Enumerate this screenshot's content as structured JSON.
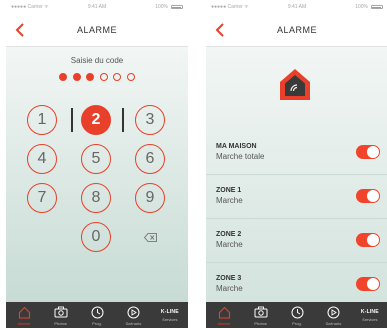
{
  "colors": {
    "accent": "#e8402a",
    "toggle_on": "#f0452b",
    "tab_bar": "#3a3a3a"
  },
  "status_bar": {
    "carrier": "●●●●● Carrier ᯤ",
    "time": "9:41 AM",
    "battery": "100%",
    "battery_level": 1.0
  },
  "keypad_screen": {
    "title": "ALARME",
    "code_label": "Saisie du code",
    "code_length": 6,
    "entered_digits": 3,
    "keys": [
      "1",
      "2",
      "3",
      "4",
      "5",
      "6",
      "7",
      "8",
      "9",
      "0"
    ],
    "active_key": "2",
    "delete_icon": "backspace-icon"
  },
  "alarm_screen": {
    "title": "ALARME",
    "house_icon": "house-wifi-icon",
    "zones": [
      {
        "name": "MA MAISON",
        "status": "Marche totale",
        "enabled": true
      },
      {
        "name": "ZONE 1",
        "status": "Marche",
        "enabled": true
      },
      {
        "name": "ZONE 2",
        "status": "Marche",
        "enabled": true
      },
      {
        "name": "ZONE 3",
        "status": "Marche",
        "enabled": true
      }
    ]
  },
  "tab_bar": {
    "items": [
      {
        "label": "Alarme",
        "icon": "house-icon",
        "active": true
      },
      {
        "label": "Photos",
        "icon": "camera-icon",
        "active": false
      },
      {
        "label": "Prog.",
        "icon": "clock-icon",
        "active": false
      },
      {
        "label": "Scénario",
        "icon": "play-icon",
        "active": false
      },
      {
        "label": "Services",
        "icon": "k-line-logo",
        "brand": "K-LINE",
        "active": false
      }
    ]
  }
}
